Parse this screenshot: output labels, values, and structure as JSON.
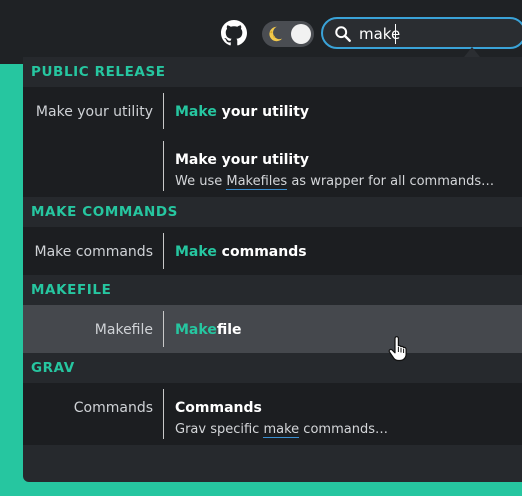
{
  "search": {
    "value": "make",
    "placeholder": ""
  },
  "results": {
    "public_release": {
      "heading": "PUBLIC RELEASE",
      "row1": {
        "left": "Make your utility",
        "hl": "Make",
        "rest": " your utility"
      },
      "row2": {
        "title": "Make your utility",
        "desc_pre": "We use ",
        "desc_u": "Makefiles",
        "desc_post": " as wrapper for all commands…"
      }
    },
    "make_commands": {
      "heading": "MAKE COMMANDS",
      "row1": {
        "left": "Make commands",
        "hl": "Make",
        "rest": " commands"
      }
    },
    "makefile": {
      "heading": "MAKEFILE",
      "row1": {
        "left": "Makefile",
        "hl": "Make",
        "rest": "file"
      }
    },
    "grav": {
      "heading": "GRAV",
      "row1": {
        "left": "Commands",
        "title": "Commands",
        "desc_pre": "Grav specific ",
        "desc_u": "make",
        "desc_post": " commands…"
      }
    }
  },
  "colors": {
    "accent": "#26c6a0",
    "focus": "#3aa3d8",
    "panel": "#26292d"
  },
  "icons": {
    "github": "github-icon",
    "theme": "moon-icon",
    "search": "search-icon"
  }
}
